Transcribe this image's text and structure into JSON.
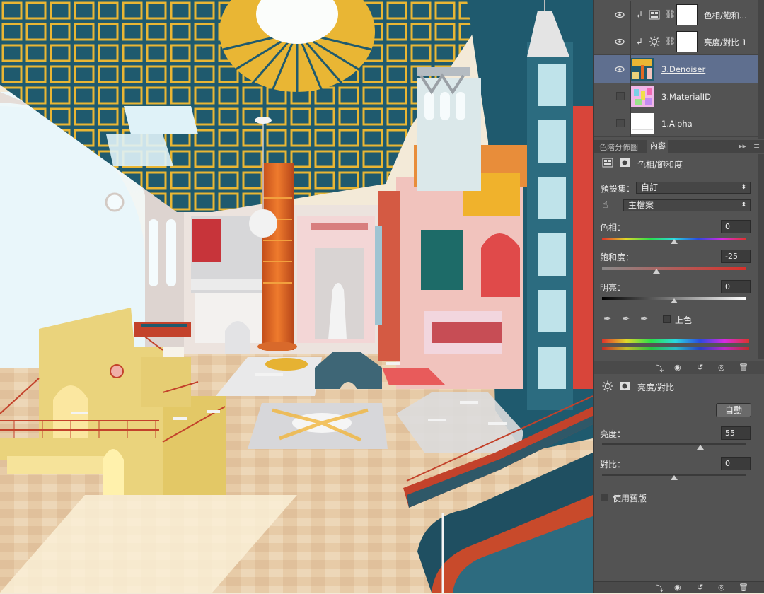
{
  "layers": [
    {
      "name": "色相/飽和...",
      "kind": "adjustment",
      "visible": true
    },
    {
      "name": "亮度/對比 1",
      "kind": "adjustment",
      "visible": true
    },
    {
      "name": "3.Denoiser",
      "kind": "pixel",
      "visible": true,
      "selected": true
    },
    {
      "name": "3.MaterialID",
      "kind": "pixel",
      "visible": false
    },
    {
      "name": "1.Alpha",
      "kind": "pixel",
      "visible": false
    }
  ],
  "tabs": [
    "色階分佈圖",
    "內容"
  ],
  "hue_sat": {
    "title": "色相/飽和度",
    "preset_label": "預設集：",
    "preset_value": "自訂",
    "channel_value": "主檔案",
    "hue_label": "色相：",
    "hue_value": "0",
    "hue_level": 0.5,
    "sat_label": "飽和度：",
    "sat_value": "-25",
    "sat_level": 0.375,
    "light_label": "明亮：",
    "light_value": "0",
    "light_level": 0.5,
    "colorize_label": "上色"
  },
  "bright_contrast": {
    "title": "亮度/對比",
    "auto_label": "自動",
    "bright_label": "亮度：",
    "bright_value": "55",
    "bright_level": 0.683,
    "contrast_label": "對比：",
    "contrast_value": "0",
    "contrast_level": 0.5,
    "legacy_label": "使用舊版"
  },
  "colors": {
    "panel": "#535353",
    "selected_layer": "#5f6f8f",
    "ceiling": "#1f5a6e",
    "grid": "#e9b634",
    "pillar": "#e36a24",
    "floor": "#e6ccaa",
    "wall_yellow": "#e8d37a",
    "rail_red": "#c3422b"
  }
}
